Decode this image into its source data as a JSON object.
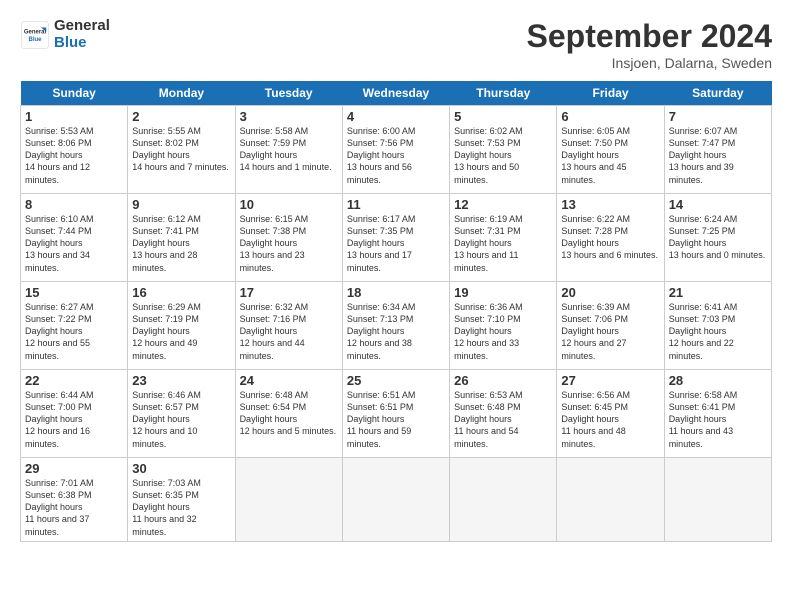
{
  "header": {
    "logo": {
      "general": "General",
      "blue": "Blue"
    },
    "title": "September 2024",
    "subtitle": "Insjoen, Dalarna, Sweden"
  },
  "columns": [
    "Sunday",
    "Monday",
    "Tuesday",
    "Wednesday",
    "Thursday",
    "Friday",
    "Saturday"
  ],
  "weeks": [
    [
      {
        "day": "1",
        "sunrise": "Sunrise: 5:53 AM",
        "sunset": "Sunset: 8:06 PM",
        "daylight": "Daylight: 14 hours and 12 minutes."
      },
      {
        "day": "2",
        "sunrise": "Sunrise: 5:55 AM",
        "sunset": "Sunset: 8:02 PM",
        "daylight": "Daylight: 14 hours and 7 minutes."
      },
      {
        "day": "3",
        "sunrise": "Sunrise: 5:58 AM",
        "sunset": "Sunset: 7:59 PM",
        "daylight": "Daylight: 14 hours and 1 minute."
      },
      {
        "day": "4",
        "sunrise": "Sunrise: 6:00 AM",
        "sunset": "Sunset: 7:56 PM",
        "daylight": "Daylight: 13 hours and 56 minutes."
      },
      {
        "day": "5",
        "sunrise": "Sunrise: 6:02 AM",
        "sunset": "Sunset: 7:53 PM",
        "daylight": "Daylight: 13 hours and 50 minutes."
      },
      {
        "day": "6",
        "sunrise": "Sunrise: 6:05 AM",
        "sunset": "Sunset: 7:50 PM",
        "daylight": "Daylight: 13 hours and 45 minutes."
      },
      {
        "day": "7",
        "sunrise": "Sunrise: 6:07 AM",
        "sunset": "Sunset: 7:47 PM",
        "daylight": "Daylight: 13 hours and 39 minutes."
      }
    ],
    [
      {
        "day": "8",
        "sunrise": "Sunrise: 6:10 AM",
        "sunset": "Sunset: 7:44 PM",
        "daylight": "Daylight: 13 hours and 34 minutes."
      },
      {
        "day": "9",
        "sunrise": "Sunrise: 6:12 AM",
        "sunset": "Sunset: 7:41 PM",
        "daylight": "Daylight: 13 hours and 28 minutes."
      },
      {
        "day": "10",
        "sunrise": "Sunrise: 6:15 AM",
        "sunset": "Sunset: 7:38 PM",
        "daylight": "Daylight: 13 hours and 23 minutes."
      },
      {
        "day": "11",
        "sunrise": "Sunrise: 6:17 AM",
        "sunset": "Sunset: 7:35 PM",
        "daylight": "Daylight: 13 hours and 17 minutes."
      },
      {
        "day": "12",
        "sunrise": "Sunrise: 6:19 AM",
        "sunset": "Sunset: 7:31 PM",
        "daylight": "Daylight: 13 hours and 11 minutes."
      },
      {
        "day": "13",
        "sunrise": "Sunrise: 6:22 AM",
        "sunset": "Sunset: 7:28 PM",
        "daylight": "Daylight: 13 hours and 6 minutes."
      },
      {
        "day": "14",
        "sunrise": "Sunrise: 6:24 AM",
        "sunset": "Sunset: 7:25 PM",
        "daylight": "Daylight: 13 hours and 0 minutes."
      }
    ],
    [
      {
        "day": "15",
        "sunrise": "Sunrise: 6:27 AM",
        "sunset": "Sunset: 7:22 PM",
        "daylight": "Daylight: 12 hours and 55 minutes."
      },
      {
        "day": "16",
        "sunrise": "Sunrise: 6:29 AM",
        "sunset": "Sunset: 7:19 PM",
        "daylight": "Daylight: 12 hours and 49 minutes."
      },
      {
        "day": "17",
        "sunrise": "Sunrise: 6:32 AM",
        "sunset": "Sunset: 7:16 PM",
        "daylight": "Daylight: 12 hours and 44 minutes."
      },
      {
        "day": "18",
        "sunrise": "Sunrise: 6:34 AM",
        "sunset": "Sunset: 7:13 PM",
        "daylight": "Daylight: 12 hours and 38 minutes."
      },
      {
        "day": "19",
        "sunrise": "Sunrise: 6:36 AM",
        "sunset": "Sunset: 7:10 PM",
        "daylight": "Daylight: 12 hours and 33 minutes."
      },
      {
        "day": "20",
        "sunrise": "Sunrise: 6:39 AM",
        "sunset": "Sunset: 7:06 PM",
        "daylight": "Daylight: 12 hours and 27 minutes."
      },
      {
        "day": "21",
        "sunrise": "Sunrise: 6:41 AM",
        "sunset": "Sunset: 7:03 PM",
        "daylight": "Daylight: 12 hours and 22 minutes."
      }
    ],
    [
      {
        "day": "22",
        "sunrise": "Sunrise: 6:44 AM",
        "sunset": "Sunset: 7:00 PM",
        "daylight": "Daylight: 12 hours and 16 minutes."
      },
      {
        "day": "23",
        "sunrise": "Sunrise: 6:46 AM",
        "sunset": "Sunset: 6:57 PM",
        "daylight": "Daylight: 12 hours and 10 minutes."
      },
      {
        "day": "24",
        "sunrise": "Sunrise: 6:48 AM",
        "sunset": "Sunset: 6:54 PM",
        "daylight": "Daylight: 12 hours and 5 minutes."
      },
      {
        "day": "25",
        "sunrise": "Sunrise: 6:51 AM",
        "sunset": "Sunset: 6:51 PM",
        "daylight": "Daylight: 11 hours and 59 minutes."
      },
      {
        "day": "26",
        "sunrise": "Sunrise: 6:53 AM",
        "sunset": "Sunset: 6:48 PM",
        "daylight": "Daylight: 11 hours and 54 minutes."
      },
      {
        "day": "27",
        "sunrise": "Sunrise: 6:56 AM",
        "sunset": "Sunset: 6:45 PM",
        "daylight": "Daylight: 11 hours and 48 minutes."
      },
      {
        "day": "28",
        "sunrise": "Sunrise: 6:58 AM",
        "sunset": "Sunset: 6:41 PM",
        "daylight": "Daylight: 11 hours and 43 minutes."
      }
    ],
    [
      {
        "day": "29",
        "sunrise": "Sunrise: 7:01 AM",
        "sunset": "Sunset: 6:38 PM",
        "daylight": "Daylight: 11 hours and 37 minutes."
      },
      {
        "day": "30",
        "sunrise": "Sunrise: 7:03 AM",
        "sunset": "Sunset: 6:35 PM",
        "daylight": "Daylight: 11 hours and 32 minutes."
      },
      null,
      null,
      null,
      null,
      null
    ]
  ]
}
